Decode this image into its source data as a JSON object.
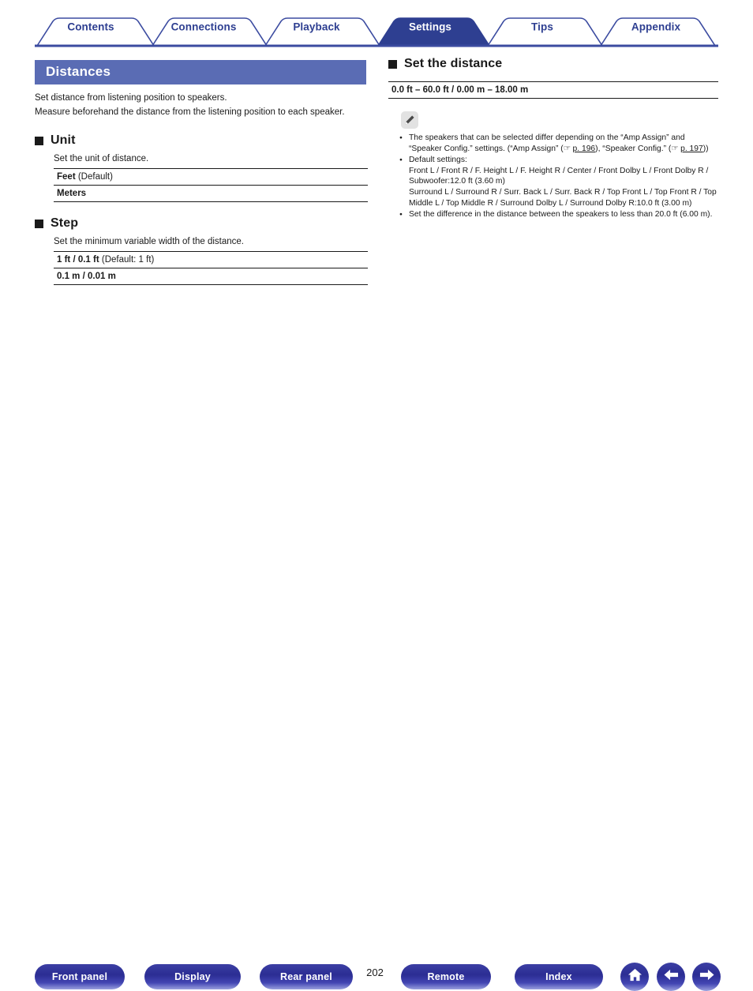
{
  "tabs": [
    {
      "label": "Contents",
      "active": false
    },
    {
      "label": "Connections",
      "active": false
    },
    {
      "label": "Playback",
      "active": false
    },
    {
      "label": "Settings",
      "active": true
    },
    {
      "label": "Tips",
      "active": false
    },
    {
      "label": "Appendix",
      "active": false
    }
  ],
  "page": {
    "title": "Distances",
    "intro_line1": "Set distance from listening position to speakers.",
    "intro_line2": "Measure beforehand the distance from the listening position to each speaker.",
    "page_number": "202"
  },
  "sections": {
    "unit": {
      "heading": "Unit",
      "description": "Set the unit of distance.",
      "rows": [
        {
          "value": "Feet",
          "suffix": " (Default)"
        },
        {
          "value": "Meters",
          "suffix": ""
        }
      ]
    },
    "step": {
      "heading": "Step",
      "description": "Set the minimum variable width of the distance.",
      "rows": [
        {
          "value": "1 ft / 0.1 ft",
          "suffix": " (Default: 1 ft)"
        },
        {
          "value": "0.1 m / 0.01 m",
          "suffix": ""
        }
      ]
    },
    "set_the_distance": {
      "heading": "Set the distance",
      "range_row": "0.0 ft – 60.0 ft / 0.00 m – 18.00 m",
      "note_icon": "pencil-icon",
      "notes": [
        {
          "id": "note-speakers-differ",
          "part1": "The speakers that can be selected differ depending on the “Amp Assign” and “Speaker Config.” settings. (“Amp Assign” (",
          "hand1": "☞",
          "link1": "p. 196",
          "part2": "), “Speaker Config.” (",
          "hand2": "☞",
          "link2": "p. 197",
          "part3": "))"
        },
        {
          "id": "note-default-settings",
          "lead": "Default settings:",
          "line1": "Front L / Front R / F. Height L / F. Height R / Center / Front Dolby L / Front Dolby R / Subwoofer:12.0 ft (3.60 m)",
          "line2": "Surround L / Surround R / Surr. Back L / Surr. Back R / Top Front L / Top Front R / Top Middle L / Top Middle R / Surround Dolby L / Surround Dolby R:10.0 ft (3.00 m)"
        },
        {
          "id": "note-difference",
          "text": "Set the difference in the distance between the speakers to less than 20.0 ft (6.00 m)."
        }
      ]
    }
  },
  "footer": {
    "buttons": [
      {
        "label": "Front panel"
      },
      {
        "label": "Display"
      },
      {
        "label": "Rear panel"
      },
      {
        "label": "Remote"
      },
      {
        "label": "Index"
      }
    ],
    "icon_buttons": [
      {
        "name": "home-icon"
      },
      {
        "name": "arrow-left-icon"
      },
      {
        "name": "arrow-right-icon"
      }
    ]
  },
  "colors": {
    "tab_blue": "#2e3f91",
    "title_bar_blue": "#5a6cb4",
    "button_blue": "#2b2d93"
  }
}
